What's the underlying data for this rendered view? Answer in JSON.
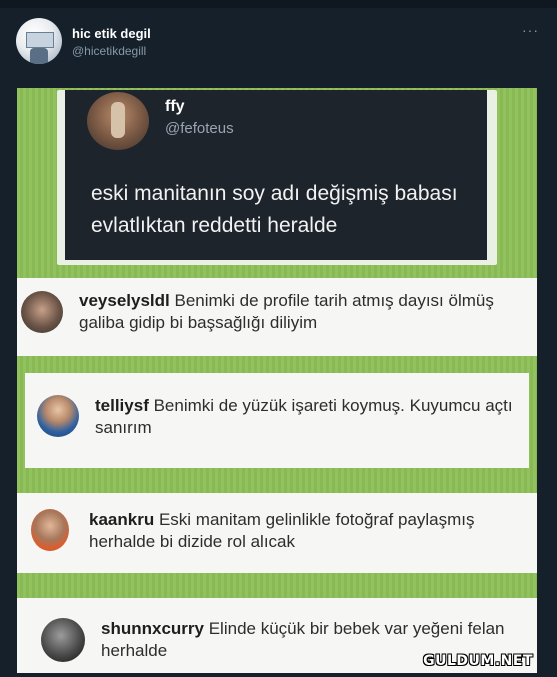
{
  "header": {
    "display_name": "hic etik degil",
    "handle": "@hicetikdegill",
    "more_label": "···"
  },
  "embedded_tweet": {
    "name": "ffy",
    "handle": "@fefoteus",
    "text": "eski manitanın soy adı değişmiş babası evlatlıktan reddetti heralde"
  },
  "comments": [
    {
      "user": "veyselysldl",
      "text": "Benimki de profile tarih atmış dayısı ölmüş galiba gidip bi başsağlığı diliyim"
    },
    {
      "user": "telliysf",
      "text": "Benimki de yüzük işareti koymuş. Kuyumcu açtı sanırım"
    },
    {
      "user": "kaankru",
      "text": "Eski manitam gelinlikle fotoğraf paylaşmış herhalde bi dizide rol alıcak"
    },
    {
      "user": "shunnxcurry",
      "text": "Elinde küçük bir bebek var yeğeni felan herhalde"
    }
  ],
  "watermark": "GULDUM.NET",
  "colors": {
    "background": "#15202b",
    "meme_green": "#8dbf57",
    "tweet_dark": "#1e242c",
    "card": "#f6f6f4"
  }
}
